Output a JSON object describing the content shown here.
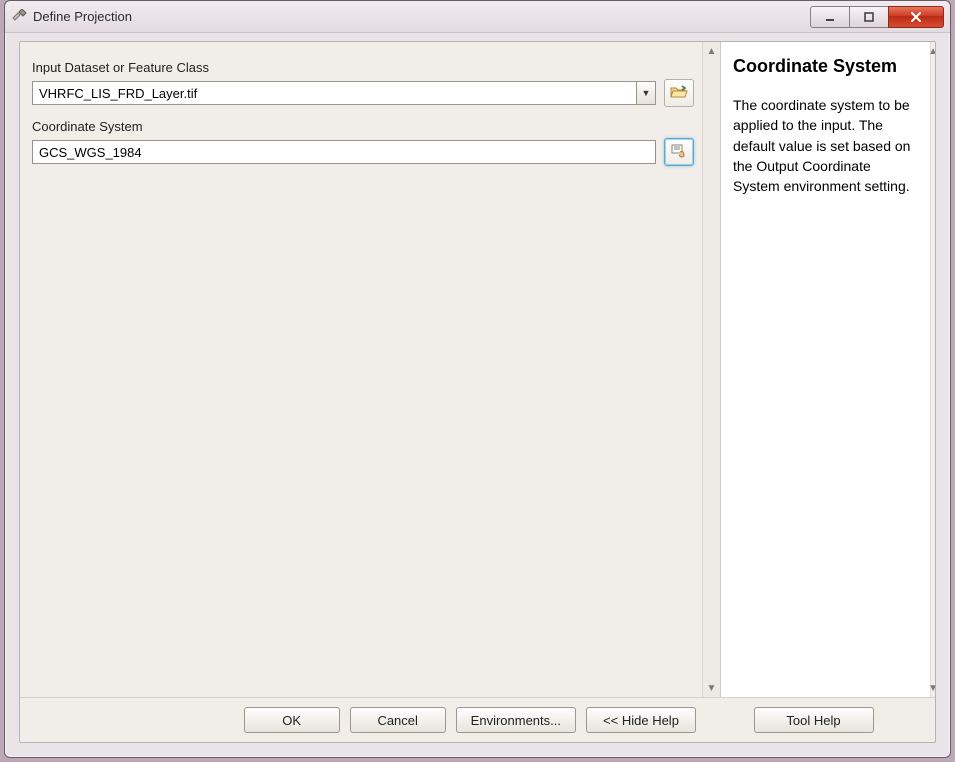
{
  "window": {
    "title": "Define Projection",
    "icon": "hammer-icon"
  },
  "form": {
    "input_dataset": {
      "label": "Input Dataset or Feature Class",
      "value": "VHRFC_LIS_FRD_Layer.tif",
      "browse_icon": "folder-open-icon"
    },
    "coordinate_system": {
      "label": "Coordinate System",
      "value": "GCS_WGS_1984",
      "props_icon": "properties-hand-icon"
    }
  },
  "buttons": {
    "ok": "OK",
    "cancel": "Cancel",
    "environments": "Environments...",
    "hide_help": "<< Hide Help",
    "tool_help": "Tool Help"
  },
  "help": {
    "title": "Coordinate System",
    "body": "The coordinate system to be applied to the input. The default value is set based on the Output Coordinate System environment setting."
  }
}
